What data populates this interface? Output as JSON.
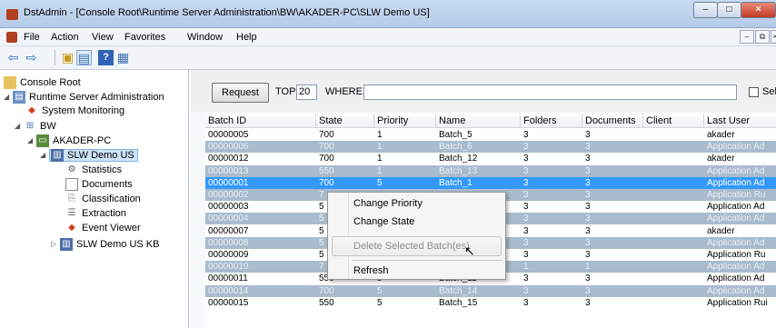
{
  "window": {
    "title": "DstAdmin - [Console Root\\Runtime Server Administration\\BW\\AKADER-PC\\SLW Demo US]",
    "controls": {
      "minimize": "–",
      "maximize": "□",
      "close": "×"
    }
  },
  "menubar": {
    "items": [
      "File",
      "Action",
      "View",
      "Favorites",
      "Window",
      "Help"
    ],
    "mdi_controls": {
      "minimize": "–",
      "restore": "⧉",
      "close": "×"
    }
  },
  "toolbar": {
    "icons": [
      "back-arrow-icon",
      "forward-arrow-icon",
      "folder-up-icon",
      "show-tree-icon",
      "help-icon",
      "panel-icon"
    ]
  },
  "tree": {
    "items": [
      {
        "label": "Console Root",
        "icon": "folder-icon"
      },
      {
        "label": "Runtime Server Administration",
        "icon": "server-admin-icon"
      },
      {
        "label": "System Monitoring",
        "icon": "monitoring-icon"
      },
      {
        "label": "BW",
        "icon": "network-icon"
      },
      {
        "label": "AKADER-PC",
        "icon": "computer-icon"
      },
      {
        "label": "SLW Demo US",
        "icon": "project-icon"
      },
      {
        "label": "Statistics",
        "icon": "statistics-icon"
      },
      {
        "label": "Documents",
        "icon": "document-icon"
      },
      {
        "label": "Classification",
        "icon": "classification-icon"
      },
      {
        "label": "Extraction",
        "icon": "extraction-icon"
      },
      {
        "label": "Event Viewer",
        "icon": "event-viewer-icon"
      },
      {
        "label": "SLW Demo US KB",
        "icon": "project-icon"
      }
    ]
  },
  "query": {
    "request_label": "Request",
    "top_label": "TOP",
    "top_value": "20",
    "where_label": "WHERE",
    "where_value": "",
    "select_label": "Sele"
  },
  "grid": {
    "columns": [
      "Batch ID",
      "State",
      "Priority",
      "Name",
      "Folders",
      "Documents",
      "Client",
      "Last User"
    ],
    "rows": [
      {
        "id": "00000005",
        "state": "700",
        "priority": "1",
        "name": "Batch_5",
        "folders": "3",
        "documents": "3",
        "client": "",
        "last_user": "akader",
        "style": "normal"
      },
      {
        "id": "00000006",
        "state": "700",
        "priority": "1",
        "name": "Batch_6",
        "folders": "3",
        "documents": "3",
        "client": "",
        "last_user": "Application Ad",
        "style": "dim"
      },
      {
        "id": "00000012",
        "state": "700",
        "priority": "1",
        "name": "Batch_12",
        "folders": "3",
        "documents": "3",
        "client": "",
        "last_user": "akader",
        "style": "normal"
      },
      {
        "id": "00000013",
        "state": "550",
        "priority": "1",
        "name": "Batch_13",
        "folders": "3",
        "documents": "3",
        "client": "",
        "last_user": "Application Ad",
        "style": "dim"
      },
      {
        "id": "00000001",
        "state": "700",
        "priority": "5",
        "name": "Batch_1",
        "folders": "3",
        "documents": "3",
        "client": "",
        "last_user": "Application Ad",
        "style": "sel"
      },
      {
        "id": "00000002",
        "state": "7",
        "priority": "",
        "name": "",
        "folders": "3",
        "documents": "3",
        "client": "",
        "last_user": "Application Ru",
        "style": "dim"
      },
      {
        "id": "00000003",
        "state": "5",
        "priority": "",
        "name": "",
        "folders": "3",
        "documents": "3",
        "client": "",
        "last_user": "Application Ad",
        "style": "normal"
      },
      {
        "id": "00000004",
        "state": "5",
        "priority": "",
        "name": "",
        "folders": "3",
        "documents": "3",
        "client": "",
        "last_user": "Application Ad",
        "style": "dim"
      },
      {
        "id": "00000007",
        "state": "5",
        "priority": "",
        "name": "",
        "folders": "3",
        "documents": "3",
        "client": "",
        "last_user": "akader",
        "style": "normal"
      },
      {
        "id": "00000008",
        "state": "5",
        "priority": "",
        "name": "",
        "folders": "3",
        "documents": "3",
        "client": "",
        "last_user": "Application Ad",
        "style": "dim"
      },
      {
        "id": "00000009",
        "state": "5",
        "priority": "",
        "name": "",
        "folders": "3",
        "documents": "3",
        "client": "",
        "last_user": "Application Ru",
        "style": "normal"
      },
      {
        "id": "00000010",
        "state": "7",
        "priority": "",
        "name": "",
        "folders": "1",
        "documents": "1",
        "client": "",
        "last_user": "Application Ad",
        "style": "dim"
      },
      {
        "id": "00000011",
        "state": "550",
        "priority": "5",
        "name": "Batch_11",
        "folders": "3",
        "documents": "3",
        "client": "",
        "last_user": "Application Ad",
        "style": "normal"
      },
      {
        "id": "00000014",
        "state": "700",
        "priority": "5",
        "name": "Batch_14",
        "folders": "3",
        "documents": "3",
        "client": "",
        "last_user": "Application Ad",
        "style": "dim"
      },
      {
        "id": "00000015",
        "state": "550",
        "priority": "5",
        "name": "Batch_15",
        "folders": "3",
        "documents": "3",
        "client": "",
        "last_user": "Application Rui",
        "style": "normal"
      }
    ]
  },
  "context_menu": {
    "items": [
      {
        "label": "Change Priority",
        "enabled": true
      },
      {
        "label": "Change State",
        "enabled": true
      },
      {
        "label": "Delete Selected Batch(es)",
        "enabled": false
      },
      {
        "label": "Refresh",
        "enabled": true
      }
    ]
  },
  "colors": {
    "selection": "#3399ff",
    "dim_row": "#a9bccd",
    "disabled_text": "#8d8d8d"
  }
}
